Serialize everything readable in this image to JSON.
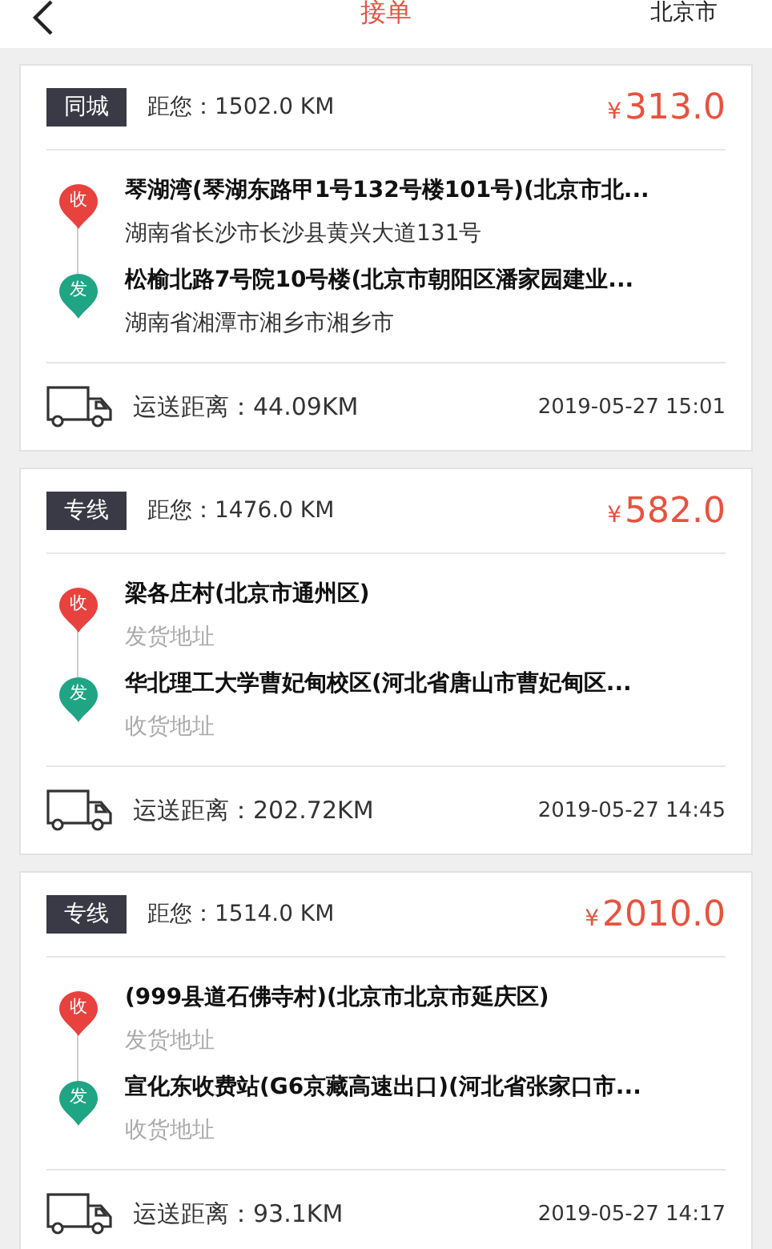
{
  "header": {
    "title": "接单",
    "city": "北京市"
  },
  "orders": [
    {
      "tag": "同城",
      "distance": "距您：1502.0 KM",
      "currency": "¥",
      "price": "313.0",
      "stops": [
        {
          "marker": "收",
          "color": "#e8423f",
          "name": "琴湖湾(琴湖东路甲1号132号楼101号)(北京市北...",
          "detail": "湖南省长沙市长沙县黄兴大道131号",
          "muted": false
        },
        {
          "marker": "发",
          "color": "#1fa584",
          "name": "松榆北路7号院10号楼(北京市朝阳区潘家园建业...",
          "detail": "湖南省湘潭市湘乡市湘乡市",
          "muted": false
        }
      ],
      "route": "运送距离：44.09KM",
      "time": "2019-05-27 15:01"
    },
    {
      "tag": "专线",
      "distance": "距您：1476.0 KM",
      "currency": "¥",
      "price": "582.0",
      "stops": [
        {
          "marker": "收",
          "color": "#e8423f",
          "name": "梁各庄村(北京市通州区)",
          "detail": "发货地址",
          "muted": true
        },
        {
          "marker": "发",
          "color": "#1fa584",
          "name": "华北理工大学曹妃甸校区(河北省唐山市曹妃甸区...",
          "detail": "收货地址",
          "muted": true
        }
      ],
      "route": "运送距离：202.72KM",
      "time": "2019-05-27 14:45"
    },
    {
      "tag": "专线",
      "distance": "距您：1514.0 KM",
      "currency": "¥",
      "price": "2010.0",
      "stops": [
        {
          "marker": "收",
          "color": "#e8423f",
          "name": "(999县道石佛寺村)(北京市北京市延庆区)",
          "detail": "发货地址",
          "muted": true
        },
        {
          "marker": "发",
          "color": "#1fa584",
          "name": "宣化东收费站(G6京藏高速出口)(河北省张家口市...",
          "detail": "收货地址",
          "muted": true
        }
      ],
      "route": "运送距离：93.1KM",
      "time": "2019-05-27 14:17"
    }
  ]
}
